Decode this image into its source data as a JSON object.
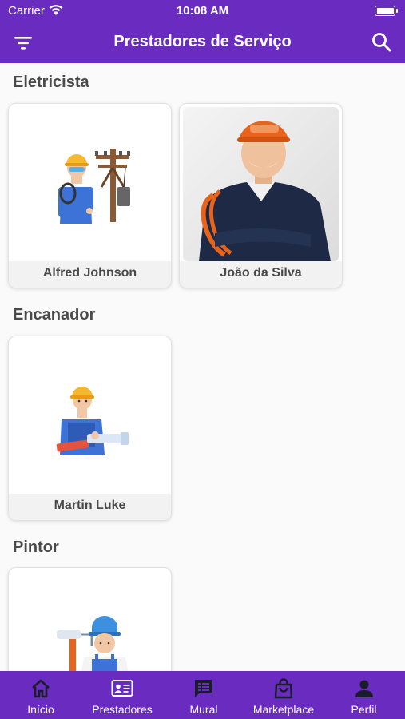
{
  "status_bar": {
    "carrier": "Carrier",
    "time": "10:08 AM"
  },
  "header": {
    "title": "Prestadores de Serviço"
  },
  "sections": [
    {
      "title": "Eletricista",
      "providers": [
        {
          "name": "Alfred Johnson"
        },
        {
          "name": "João da Silva"
        }
      ]
    },
    {
      "title": "Encanador",
      "providers": [
        {
          "name": "Martin Luke"
        }
      ]
    },
    {
      "title": "Pintor",
      "providers": [
        {
          "name": ""
        }
      ]
    }
  ],
  "tabs": [
    {
      "label": "Início",
      "icon": "home-icon"
    },
    {
      "label": "Prestadores",
      "icon": "id-card-icon",
      "active": true
    },
    {
      "label": "Mural",
      "icon": "chat-list-icon"
    },
    {
      "label": "Marketplace",
      "icon": "shopping-bag-icon"
    },
    {
      "label": "Perfil",
      "icon": "person-icon"
    }
  ],
  "colors": {
    "primary": "#6a2bc0",
    "text": "#4a4a4a",
    "card_footer": "#f2f2f2"
  }
}
